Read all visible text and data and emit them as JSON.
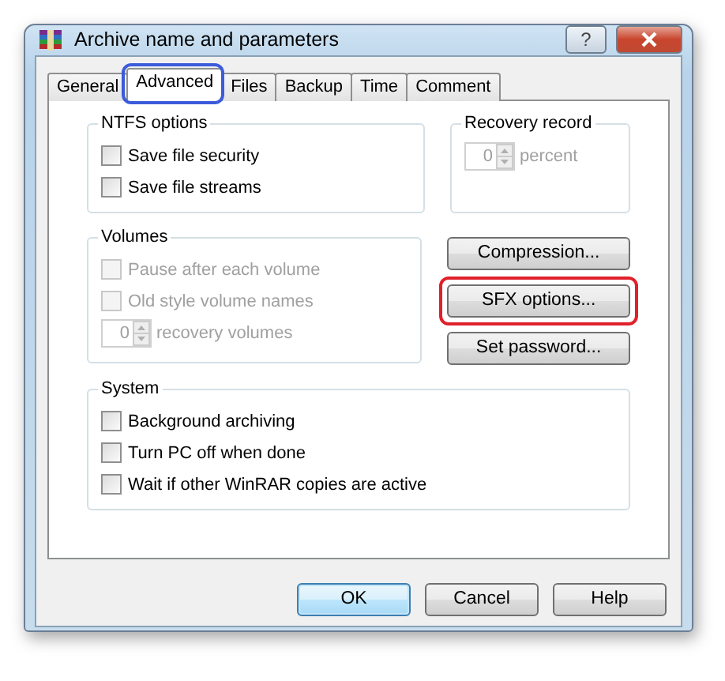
{
  "window": {
    "title": "Archive name and parameters",
    "help_button": "?"
  },
  "tabs": [
    {
      "label": "General",
      "selected": false
    },
    {
      "label": "Advanced",
      "selected": true,
      "color": "#3b5bdb"
    },
    {
      "label": "Files",
      "selected": false
    },
    {
      "label": "Backup",
      "selected": false
    },
    {
      "label": "Time",
      "selected": false
    },
    {
      "label": "Comment",
      "selected": false
    }
  ],
  "ntfs_options": {
    "title": "NTFS options",
    "options": [
      {
        "label": "Save file security",
        "checked": false,
        "disabled": false
      },
      {
        "label": "Save file streams",
        "checked": false,
        "disabled": false
      }
    ]
  },
  "recovery_record": {
    "title": "Recovery record",
    "value": "0",
    "unit": "percent",
    "disabled": true
  },
  "volumes": {
    "title": "Volumes",
    "options": [
      {
        "label": "Pause after each volume",
        "checked": false,
        "disabled": true
      },
      {
        "label": "Old style volume names",
        "checked": false,
        "disabled": true
      }
    ],
    "spinner": {
      "value": "0",
      "label": "recovery volumes",
      "disabled": true
    }
  },
  "side_buttons": [
    {
      "label": "Compression..."
    },
    {
      "label": "SFX options...",
      "color": "#e0202a"
    },
    {
      "label": "Set password..."
    }
  ],
  "system": {
    "title": "System",
    "options": [
      {
        "label": "Background archiving",
        "checked": false,
        "disabled": false
      },
      {
        "label": "Turn PC off when done",
        "checked": false,
        "disabled": false
      },
      {
        "label": "Wait if other WinRAR copies are active",
        "checked": false,
        "disabled": false
      }
    ]
  },
  "footer_buttons": [
    {
      "label": "OK",
      "default": true
    },
    {
      "label": "Cancel",
      "default": false
    },
    {
      "label": "Help",
      "default": false
    }
  ]
}
